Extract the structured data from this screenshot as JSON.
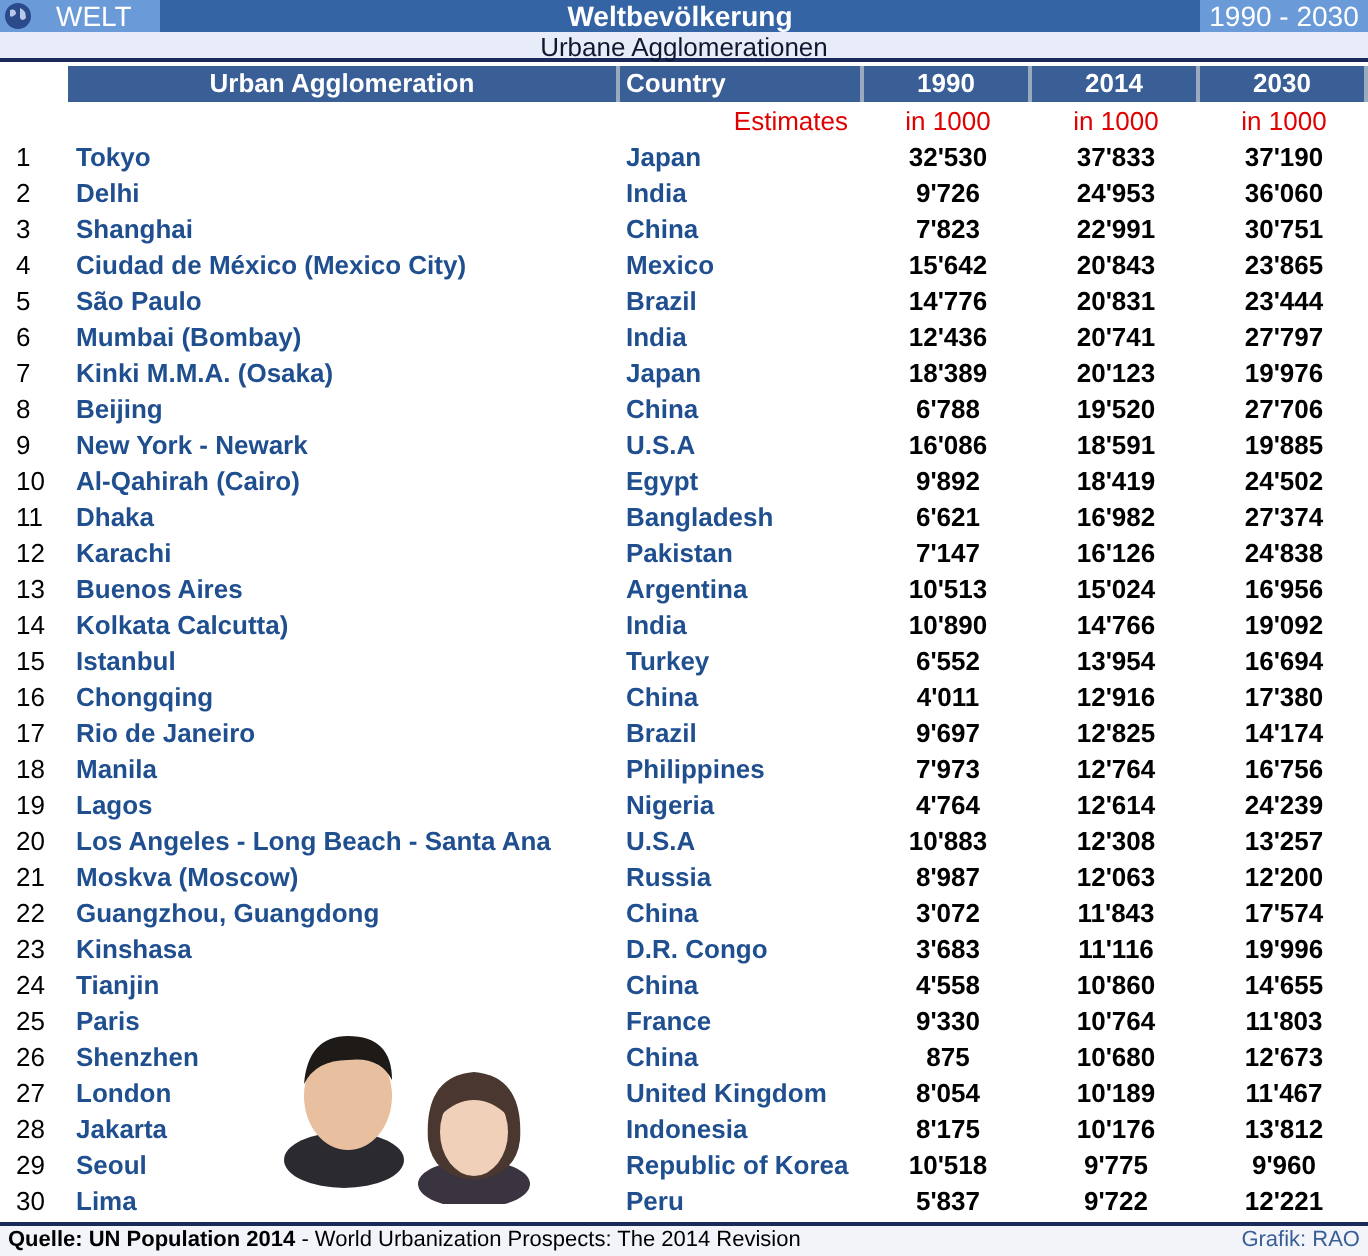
{
  "header": {
    "left": "WELT",
    "title": "Weltbevölkerung",
    "right": "1990 - 2030"
  },
  "subtitle": "Urbane Agglomerationen",
  "table": {
    "columns": [
      "",
      "Urban Agglomeration",
      "Country",
      "1990",
      "2014",
      "2030"
    ],
    "units": [
      "Estimates",
      "in 1000",
      "in 1000",
      "in 1000"
    ],
    "rows": [
      [
        "1",
        "Tokyo",
        "Japan",
        "32'530",
        "37'833",
        "37'190"
      ],
      [
        "2",
        "Delhi",
        "India",
        "9'726",
        "24'953",
        "36'060"
      ],
      [
        "3",
        "Shanghai",
        "China",
        "7'823",
        "22'991",
        "30'751"
      ],
      [
        "4",
        "Ciudad de México (Mexico City)",
        "Mexico",
        "15'642",
        "20'843",
        "23'865"
      ],
      [
        "5",
        "São Paulo",
        "Brazil",
        "14'776",
        "20'831",
        "23'444"
      ],
      [
        "6",
        "Mumbai (Bombay)",
        "India",
        "12'436",
        "20'741",
        "27'797"
      ],
      [
        "7",
        "Kinki M.M.A. (Osaka)",
        "Japan",
        "18'389",
        "20'123",
        "19'976"
      ],
      [
        "8",
        "Beijing",
        "China",
        "6'788",
        "19'520",
        "27'706"
      ],
      [
        "9",
        "New York - Newark",
        "U.S.A",
        "16'086",
        "18'591",
        "19'885"
      ],
      [
        "10",
        "Al-Qahirah (Cairo)",
        "Egypt",
        "9'892",
        "18'419",
        "24'502"
      ],
      [
        "11",
        "Dhaka",
        "Bangladesh",
        "6'621",
        "16'982",
        "27'374"
      ],
      [
        "12",
        "Karachi",
        "Pakistan",
        "7'147",
        "16'126",
        "24'838"
      ],
      [
        "13",
        "Buenos Aires",
        "Argentina",
        "10'513",
        "15'024",
        "16'956"
      ],
      [
        "14",
        "Kolkata  Calcutta)",
        "India",
        "10'890",
        "14'766",
        "19'092"
      ],
      [
        "15",
        "Istanbul",
        "Turkey",
        "6'552",
        "13'954",
        "16'694"
      ],
      [
        "16",
        "Chongqing",
        "China",
        "4'011",
        "12'916",
        "17'380"
      ],
      [
        "17",
        "Rio de Janeiro",
        "Brazil",
        "9'697",
        "12'825",
        "14'174"
      ],
      [
        "18",
        "Manila",
        "Philippines",
        "7'973",
        "12'764",
        "16'756"
      ],
      [
        "19",
        "Lagos",
        "Nigeria",
        "4'764",
        "12'614",
        "24'239"
      ],
      [
        "20",
        "Los Angeles - Long Beach - Santa Ana",
        "U.S.A",
        "10'883",
        "12'308",
        "13'257"
      ],
      [
        "21",
        "Moskva (Moscow)",
        "Russia",
        "8'987",
        "12'063",
        "12'200"
      ],
      [
        "22",
        "Guangzhou, Guangdong",
        "China",
        "3'072",
        "11'843",
        "17'574"
      ],
      [
        "23",
        "Kinshasa",
        "D.R. Congo",
        "3'683",
        "11'116",
        "19'996"
      ],
      [
        "24",
        "Tianjin",
        "China",
        "4'558",
        "10'860",
        "14'655"
      ],
      [
        "25",
        "Paris",
        "France",
        "9'330",
        "10'764",
        "11'803"
      ],
      [
        "26",
        "Shenzhen",
        "China",
        "875",
        "10'680",
        "12'673"
      ],
      [
        "27",
        "London",
        "United Kingdom",
        "8'054",
        "10'189",
        "11'467"
      ],
      [
        "28",
        "Jakarta",
        "Indonesia",
        "8'175",
        "10'176",
        "13'812"
      ],
      [
        "29",
        "Seoul",
        "Republic of Korea",
        "10'518",
        "9'775",
        "9'960"
      ],
      [
        "30",
        "Lima",
        "Peru",
        "5'837",
        "9'722",
        "12'221"
      ]
    ]
  },
  "footer": {
    "source": "**Quelle: UN Population 2014** - World Urbanization Prospects: The 2014 Revision",
    "credit": "Grafik: RAO"
  }
}
